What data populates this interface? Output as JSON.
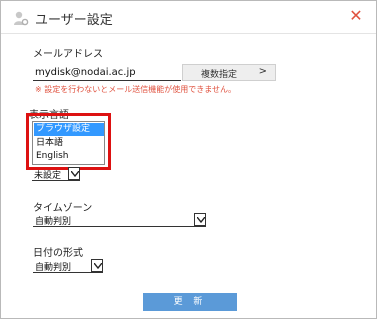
{
  "header": {
    "icon": "user-gear-icon",
    "title": "ユーザー設定",
    "close_icon": "close-icon",
    "close_glyph": "✕",
    "accent_color": "#e0523f"
  },
  "email": {
    "label": "メールアドレス",
    "value": "mydisk@nodai.ac.jp",
    "multi_button_label": "複数指定",
    "multi_button_icon": "chevron-right-icon",
    "multi_button_glyph": ">",
    "warning": "※ 設定を行わないとメール送信機能が使用できません。"
  },
  "language": {
    "label": "表示言語",
    "options": [
      "ブラウザ設定",
      "日本語",
      "English"
    ],
    "selected": "ブラウザ設定"
  },
  "hidden_select": {
    "value": "未設定"
  },
  "timezone": {
    "label": "タイムゾーン",
    "value": "自動判別"
  },
  "date_format": {
    "label": "日付の形式",
    "value": "自動判別"
  },
  "update_button": {
    "label": "更 新",
    "color": "#5b9ad8"
  },
  "highlight_color": "#dd1111"
}
